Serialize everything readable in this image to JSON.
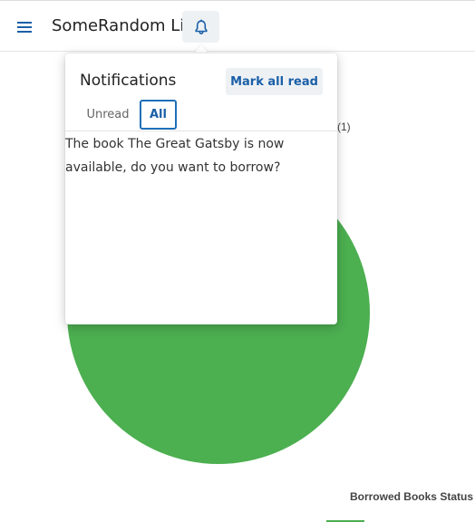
{
  "app": {
    "title": "SomeRandom Lib"
  },
  "icons": {
    "menu": "hamburger-menu-icon",
    "notifications": "bell-icon"
  },
  "colors": {
    "accent": "#1a5fa8",
    "chart_green": "#4caf50"
  },
  "notifications": {
    "title": "Notifications",
    "mark_all_read_label": "Mark all read",
    "tabs": [
      {
        "label": "Unread",
        "active": false
      },
      {
        "label": "All",
        "active": true
      }
    ],
    "items": [
      {
        "text": "The book The Great Gatsby is now available, do you want to borrow?"
      }
    ]
  },
  "chart_data": {
    "type": "pie",
    "title": "Borrowed Books Status",
    "legend_placement": "bottom",
    "labels": [
      "(1)"
    ],
    "values": [
      1
    ],
    "colors": [
      "#4caf50"
    ]
  }
}
